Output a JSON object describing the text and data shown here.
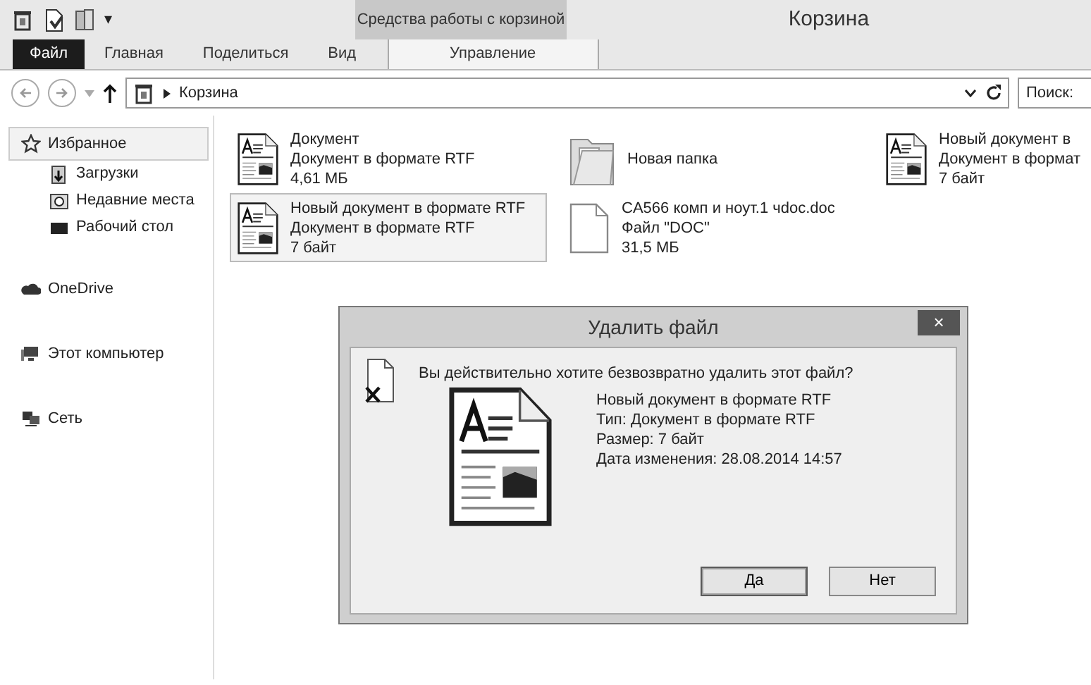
{
  "window": {
    "title": "Корзина",
    "context_tab_group": "Средства работы с корзиной"
  },
  "quick_access": {
    "overflow": "▾"
  },
  "ribbon_tabs": [
    {
      "label": "Файл",
      "kind": "file",
      "selected": false
    },
    {
      "label": "Главная",
      "kind": "tab",
      "selected": false
    },
    {
      "label": "Поделиться",
      "kind": "tab",
      "selected": false
    },
    {
      "label": "Вид",
      "kind": "tab",
      "selected": false
    },
    {
      "label": "Управление",
      "kind": "context",
      "selected": false
    }
  ],
  "address_bar": {
    "path": "Корзина",
    "search_placeholder": "Поиск:"
  },
  "sidebar": {
    "items": [
      {
        "label": "Избранное",
        "kind": "star",
        "selected": true,
        "children": [
          {
            "label": "Загрузки",
            "kind": "downloads",
            "selected": false
          },
          {
            "label": "Недавние места",
            "kind": "recent",
            "selected": false
          },
          {
            "label": "Рабочий стол",
            "kind": "desktop",
            "selected": false
          }
        ]
      },
      {
        "label": "OneDrive",
        "kind": "cloud",
        "selected": false
      },
      {
        "label": "Этот компьютер",
        "kind": "computer",
        "selected": false
      },
      {
        "label": "Сеть",
        "kind": "network",
        "selected": false
      }
    ]
  },
  "files": [
    {
      "kind": "rtf",
      "name": "Документ",
      "type": "Документ в формате RTF",
      "size": "4,61 МБ",
      "selected": false
    },
    {
      "kind": "folder",
      "name": "Новая папка",
      "selected": false
    },
    {
      "kind": "rtf",
      "name": "Новый документ в",
      "type": "Документ в формат",
      "size": "7 байт",
      "selected": false
    },
    {
      "kind": "rtf",
      "name": "Новый документ в формате RTF",
      "type": "Документ в формате RTF",
      "size": "7 байт",
      "selected": true
    },
    {
      "kind": "doc",
      "name": "CA566 комп и ноут.1 чdoc.doc",
      "type": "Файл \"DOC\"",
      "size": "31,5 МБ",
      "selected": false
    }
  ],
  "dialog": {
    "title": "Удалить файл",
    "close": "×",
    "question": "Вы действительно хотите безвозвратно удалить этот файл?",
    "details": [
      "Новый документ в формате RTF",
      "Тип: Документ в формате RTF",
      "Размер: 7 байт",
      "Дата изменения: 28.08.2014 14:57"
    ],
    "buttons": [
      {
        "label": "Да",
        "default": true
      },
      {
        "label": "Нет",
        "default": false
      }
    ]
  }
}
